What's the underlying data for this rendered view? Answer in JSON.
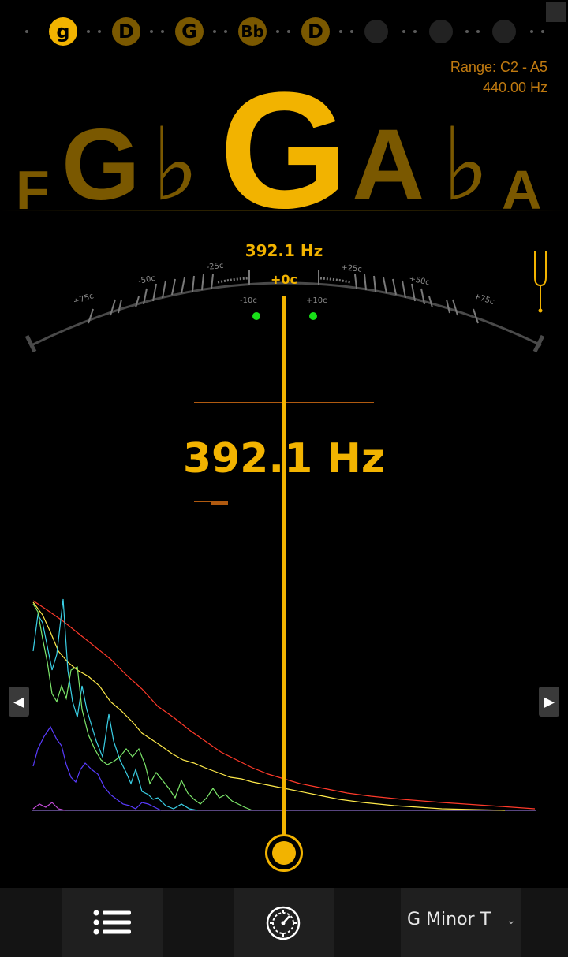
{
  "strings": [
    {
      "label": "g",
      "state": "active"
    },
    {
      "label": "D",
      "state": "idle"
    },
    {
      "label": "G",
      "state": "idle"
    },
    {
      "label": "Bb",
      "state": "idle"
    },
    {
      "label": "D",
      "state": "idle"
    },
    {
      "label": "",
      "state": "empty"
    },
    {
      "label": "",
      "state": "empty"
    },
    {
      "label": "",
      "state": "empty"
    }
  ],
  "header": {
    "range": "Range: C2 - A5",
    "reference": "440.00 Hz"
  },
  "notes": {
    "far_left": "F",
    "left": "G",
    "left_flat": "♭",
    "current": "G",
    "right": "A",
    "right_flat": "♭",
    "far_right": "A"
  },
  "gauge": {
    "frequency": "392.1 Hz",
    "cents": "+0c",
    "labels": {
      "m75": "+75c",
      "m50": "-50c",
      "m25": "-25c",
      "m10": "-10c",
      "p10": "+10c",
      "p25": "+25c",
      "p50": "+50c",
      "p75": "+75c"
    }
  },
  "reading": {
    "frequency": "392.1 Hz",
    "cents_offset": 0
  },
  "bottom_bar": {
    "menu_icon": "list-icon",
    "settings_icon": "gear-dial-icon",
    "tuning": "G Minor T"
  },
  "colors": {
    "accent": "#f2b300",
    "dim_accent": "#7a5800",
    "background": "#000000",
    "in_tune_indicator": "#18e018"
  }
}
